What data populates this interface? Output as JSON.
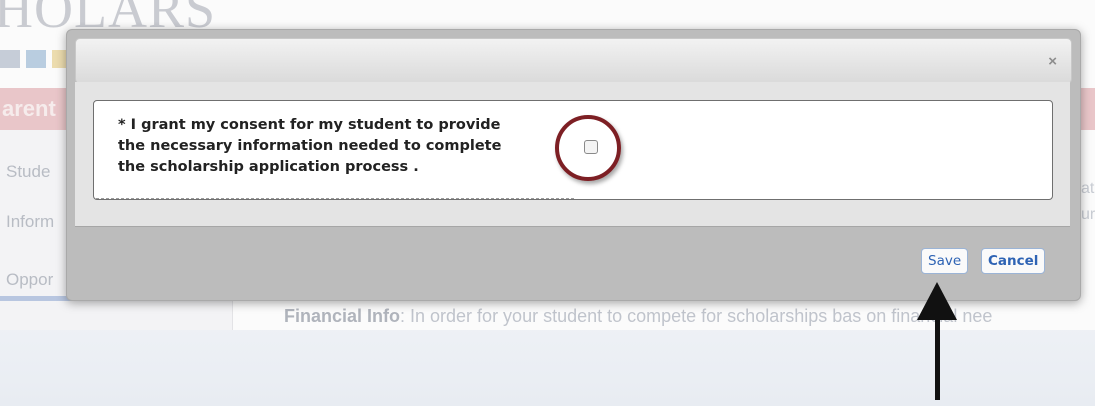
{
  "background": {
    "logo_text": "HOLARS",
    "header_text": "arent",
    "nav_items": [
      "Stude",
      "Inform",
      "Oppor"
    ],
    "right_fragments": [
      "at",
      "ur"
    ],
    "financial_label": "Financial Info",
    "financial_text": ": In order for your student to compete for scholarships bas  on financial nee",
    "swatch_colors": [
      "#c6cdd8",
      "#b9cde0",
      "#ecdcae"
    ]
  },
  "modal": {
    "close_label": "×",
    "consent_lines": [
      "* I grant my consent for my student to provide",
      "the necessary information needed to complete",
      "the scholarship application process ."
    ],
    "consent_checked": false,
    "save_label": "Save",
    "cancel_label": "Cancel"
  },
  "annotation": {
    "highlight_color": "#7d1f24",
    "arrow_color": "#111111"
  }
}
